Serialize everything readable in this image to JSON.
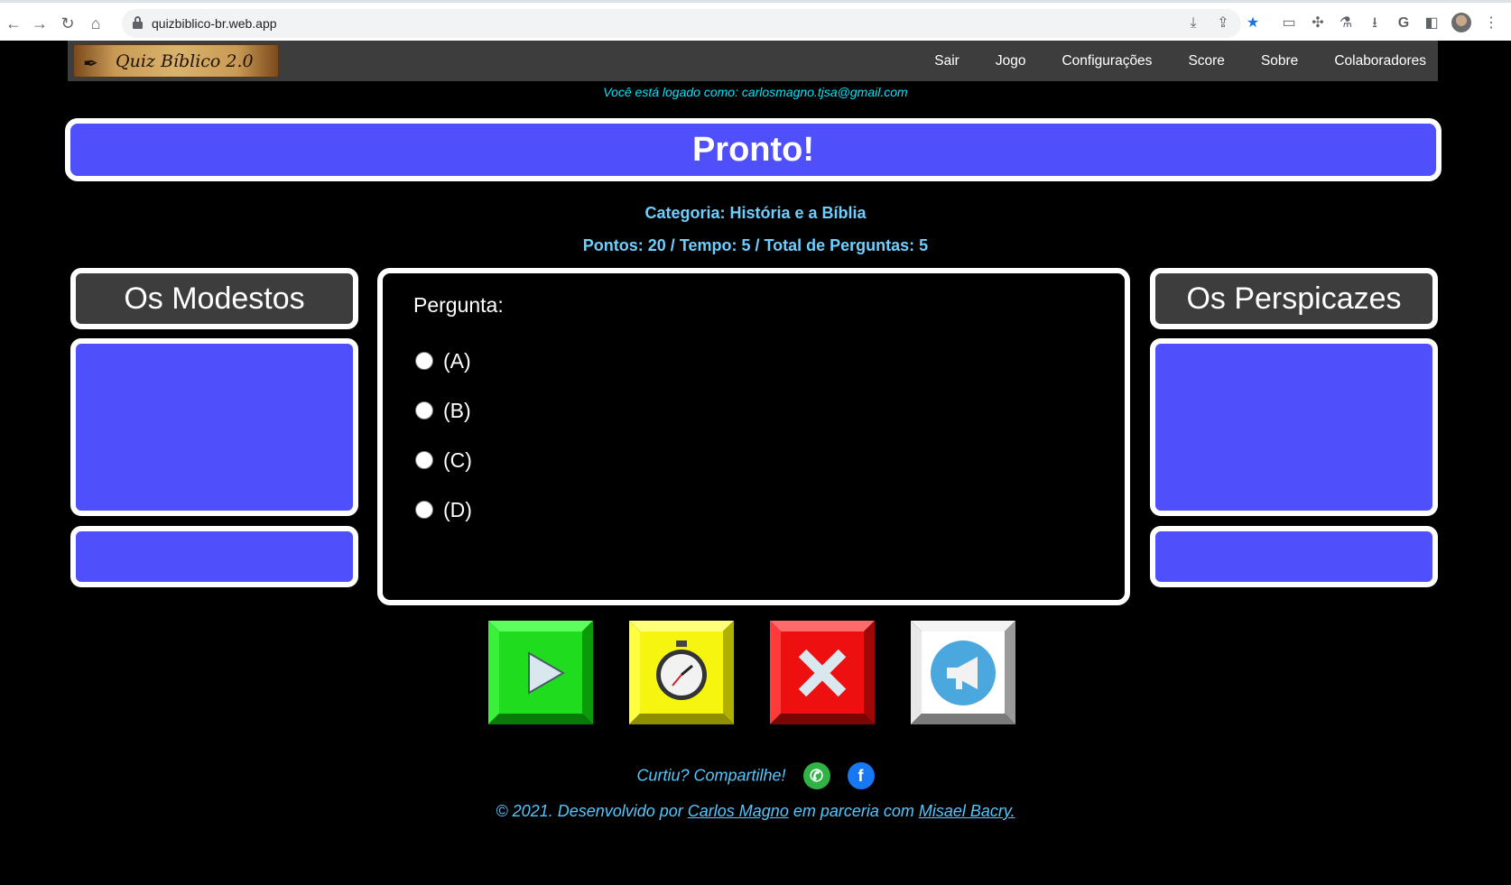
{
  "browser": {
    "url": "quizbiblico-br.web.app"
  },
  "header": {
    "logo_text": "Quiz Bíblico 2.0",
    "menu": [
      "Sair",
      "Jogo",
      "Configurações",
      "Score",
      "Sobre",
      "Colaboradores"
    ]
  },
  "logged_in": "Você está logado como: carlosmagno.tjsa@gmail.com",
  "banner": "Pronto!",
  "category": "Categoria: História e a Bíblia",
  "stats": "Pontos: 20 / Tempo: 5 / Total de Perguntas: 5",
  "teams": {
    "left": "Os Modestos",
    "right": "Os Perspicazes"
  },
  "question": {
    "label": "Pergunta:",
    "options": [
      "(A)",
      "(B)",
      "(C)",
      "(D)"
    ]
  },
  "controls": {
    "colors": {
      "play": "#1fdc1f",
      "timer": "#f5f50f",
      "close": "#ee1010",
      "announce": "#ffffff"
    }
  },
  "footer": {
    "share_text": "Curtiu? Compartilhe!",
    "copyright_prefix": "© 2021. Desenvolvido por ",
    "author": "Carlos Magno",
    "middle": " em parceria com ",
    "partner": "Misael Bacry."
  },
  "colors": {
    "panel_blue": "#4f4ffc",
    "accent_text": "#6ecfff"
  }
}
